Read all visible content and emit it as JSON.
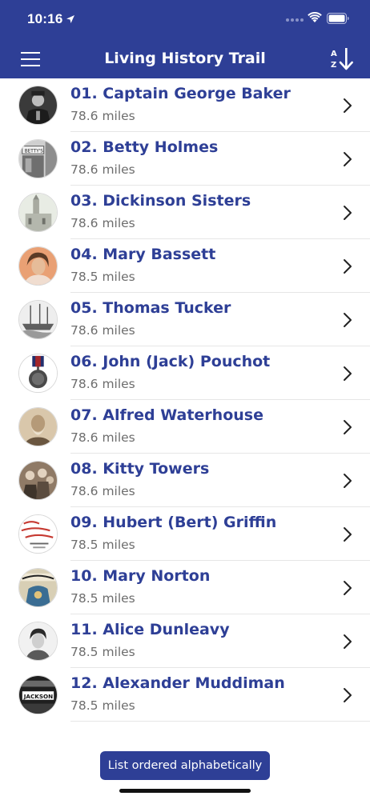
{
  "status_bar": {
    "time": "10:16"
  },
  "nav": {
    "title": "Living History Trail",
    "sort_icon": "sort-alpha-icon",
    "menu_icon": "hamburger-icon"
  },
  "colors": {
    "brand": "#2e3f96",
    "subtitle": "#6d6d6d"
  },
  "items": [
    {
      "title": "01. Captain George Baker",
      "distance": "78.6 miles",
      "thumb": "portrait-photo"
    },
    {
      "title": "02. Betty Holmes",
      "distance": "78.6 miles",
      "thumb": "shopfront-photo"
    },
    {
      "title": "03. Dickinson Sisters",
      "distance": "78.6 miles",
      "thumb": "church-photo"
    },
    {
      "title": "04. Mary Bassett",
      "distance": "78.5 miles",
      "thumb": "portrait-photo"
    },
    {
      "title": "05. Thomas Tucker",
      "distance": "78.6 miles",
      "thumb": "ship-illustration"
    },
    {
      "title": "06. John (Jack) Pouchot",
      "distance": "78.6 miles",
      "thumb": "medal-image"
    },
    {
      "title": "07. Alfred Waterhouse",
      "distance": "78.6 miles",
      "thumb": "portrait-photo"
    },
    {
      "title": "08. Kitty Towers",
      "distance": "78.6 miles",
      "thumb": "group-photo"
    },
    {
      "title": "09. Hubert (Bert) Griffin",
      "distance": "78.5 miles",
      "thumb": "postcard-image"
    },
    {
      "title": "10. Mary Norton",
      "distance": "78.5 miles",
      "thumb": "book-cover"
    },
    {
      "title": "11. Alice Dunleavy",
      "distance": "78.5 miles",
      "thumb": "portrait-photo"
    },
    {
      "title": "12. Alexander Muddiman",
      "distance": "78.5 miles",
      "thumb": "shop-sign-photo"
    }
  ],
  "toast": {
    "text": "List ordered alphabetically"
  }
}
